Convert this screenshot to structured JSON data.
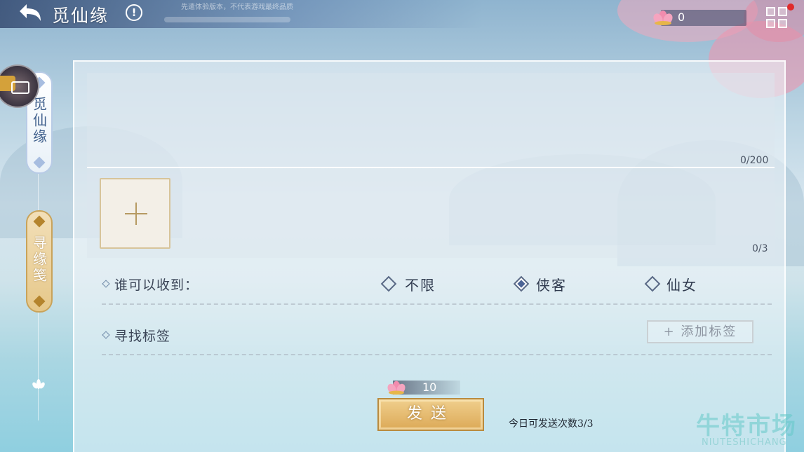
{
  "header": {
    "title": "觅仙缘",
    "disclaimer": "先遣体验版本，不代表游戏最终品质",
    "currency_value": "0"
  },
  "sidebar": {
    "tabs": [
      {
        "label": "觅仙缘",
        "active": true
      },
      {
        "label": "寻缘笺",
        "active": false
      }
    ]
  },
  "form": {
    "text_counter": "0/200",
    "image_counter": "0/3",
    "recipient": {
      "label": "谁可以收到：",
      "options": [
        {
          "label": "不限",
          "selected": false
        },
        {
          "label": "侠客",
          "selected": true
        },
        {
          "label": "仙女",
          "selected": false
        }
      ]
    },
    "tags": {
      "label": "寻找标签",
      "add_button": "+ 添加标签"
    }
  },
  "send": {
    "cost": "10",
    "button_label": "发送",
    "daily_hint": "今日可发送次数3/3"
  },
  "watermark": {
    "zh": "牛特市场",
    "en": "NIUTESHICHANG"
  },
  "colors": {
    "accent_gold": "#dca957",
    "accent_blue": "#4d6596",
    "notify_red": "#e02a2a"
  }
}
